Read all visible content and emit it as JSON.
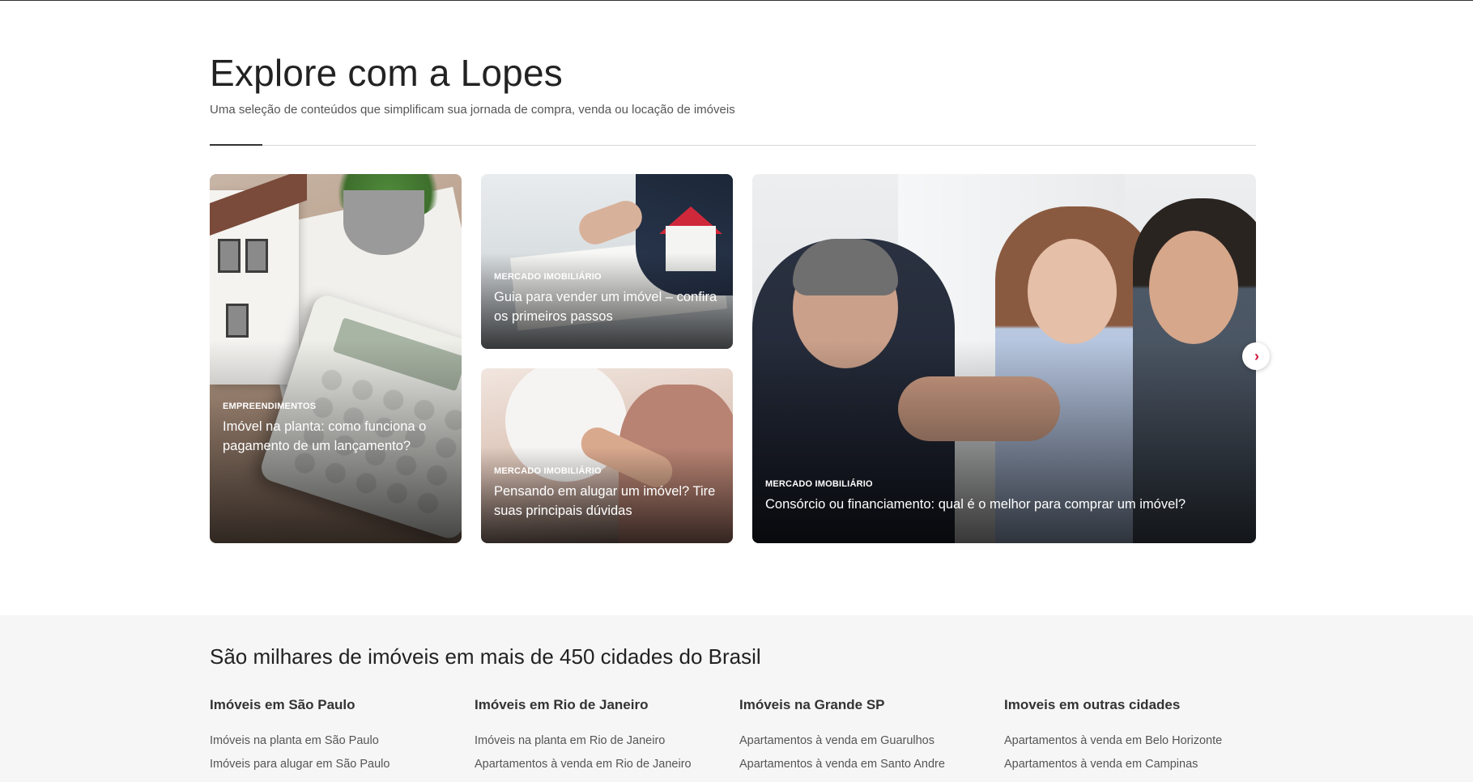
{
  "explore": {
    "title": "Explore com a Lopes",
    "subtitle": "Uma seleção de conteúdos que simplificam sua jornada de compra, venda ou locação de imóveis"
  },
  "cards": [
    {
      "category": "EMPREENDIMENTOS",
      "title": "Imóvel na planta: como funciona o pagamento de um lançamento?"
    },
    {
      "category": "MERCADO IMOBILIÁRIO",
      "title": "Guia para vender um imóvel – confira os primeiros passos"
    },
    {
      "category": "MERCADO IMOBILIÁRIO",
      "title": "Pensando em alugar um imóvel? Tire suas principais dúvidas"
    },
    {
      "category": "MERCADO IMOBILIÁRIO",
      "title": "Consórcio ou financiamento: qual é o melhor para comprar um imóvel?"
    }
  ],
  "carousel": {
    "next_icon": "chevron-right-icon",
    "next_glyph": "›"
  },
  "cities": {
    "title": "São milhares de imóveis em mais de 450 cidades do Brasil",
    "columns": [
      {
        "heading": "Imóveis em São Paulo",
        "links": [
          "Imóveis na planta em São Paulo",
          "Imóveis para alugar em São Paulo"
        ]
      },
      {
        "heading": "Imóveis em Rio de Janeiro",
        "links": [
          "Imóveis na planta em Rio de Janeiro",
          "Apartamentos à venda em Rio de Janeiro"
        ]
      },
      {
        "heading": "Imóveis na Grande SP",
        "links": [
          "Apartamentos à venda em Guarulhos",
          "Apartamentos à venda em Santo Andre"
        ]
      },
      {
        "heading": "Imoveis em outras cidades",
        "links": [
          "Apartamentos à venda em Belo Horizonte",
          "Apartamentos à venda em Campinas"
        ]
      }
    ]
  },
  "colors": {
    "accent": "#d0163f",
    "footer_bg": "#f6f6f6"
  }
}
